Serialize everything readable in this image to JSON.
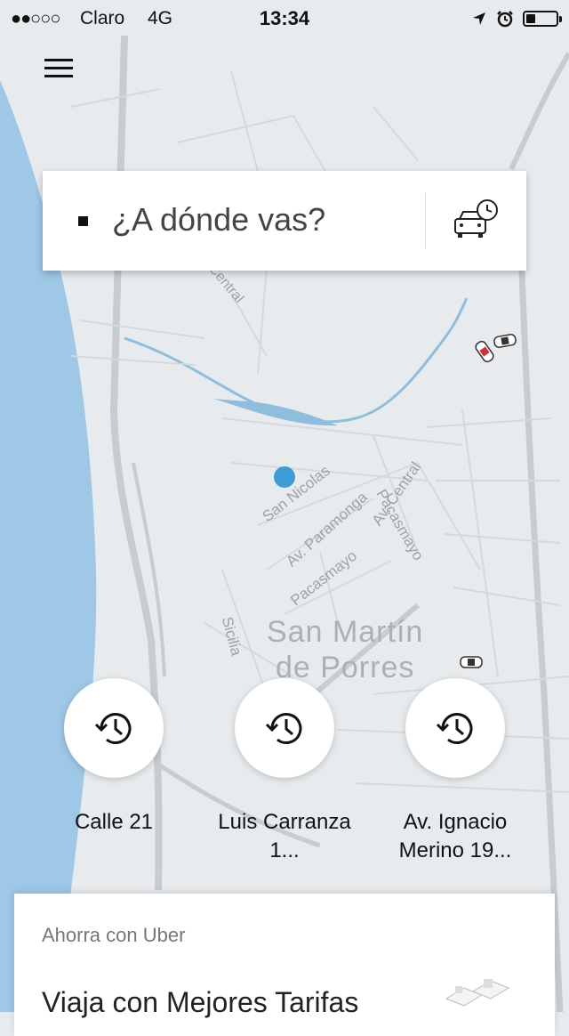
{
  "status_bar": {
    "signal": "●●○○○",
    "carrier": "Claro",
    "network": "4G",
    "time": "13:34",
    "battery_level": 0.3
  },
  "search": {
    "placeholder": "¿A dónde vas?",
    "schedule_icon": "car-clock-icon"
  },
  "map": {
    "district_name_line1": "San Martín",
    "district_name_line2": "de Porres",
    "streets": [
      "Central",
      "San Nicolas",
      "Av. Paramonga",
      "Av. Central",
      "Pacasmayo",
      "Sicilia",
      "Pacasmayo"
    ],
    "colors": {
      "water": "#9fc7e6",
      "land": "#e8ebed",
      "river": "#8fbedc",
      "user_dot": "#3d9bd6"
    }
  },
  "shortcuts": [
    {
      "label": "Calle 21",
      "icon": "history-clock-icon"
    },
    {
      "label": "Luis Carranza 1...",
      "icon": "history-clock-icon"
    },
    {
      "label": "Av. Ignacio Merino 19...",
      "icon": "history-clock-icon"
    }
  ],
  "promo_card": {
    "kicker": "Ahorra con Uber",
    "headline": "Viaja con Mejores Tarifas"
  }
}
